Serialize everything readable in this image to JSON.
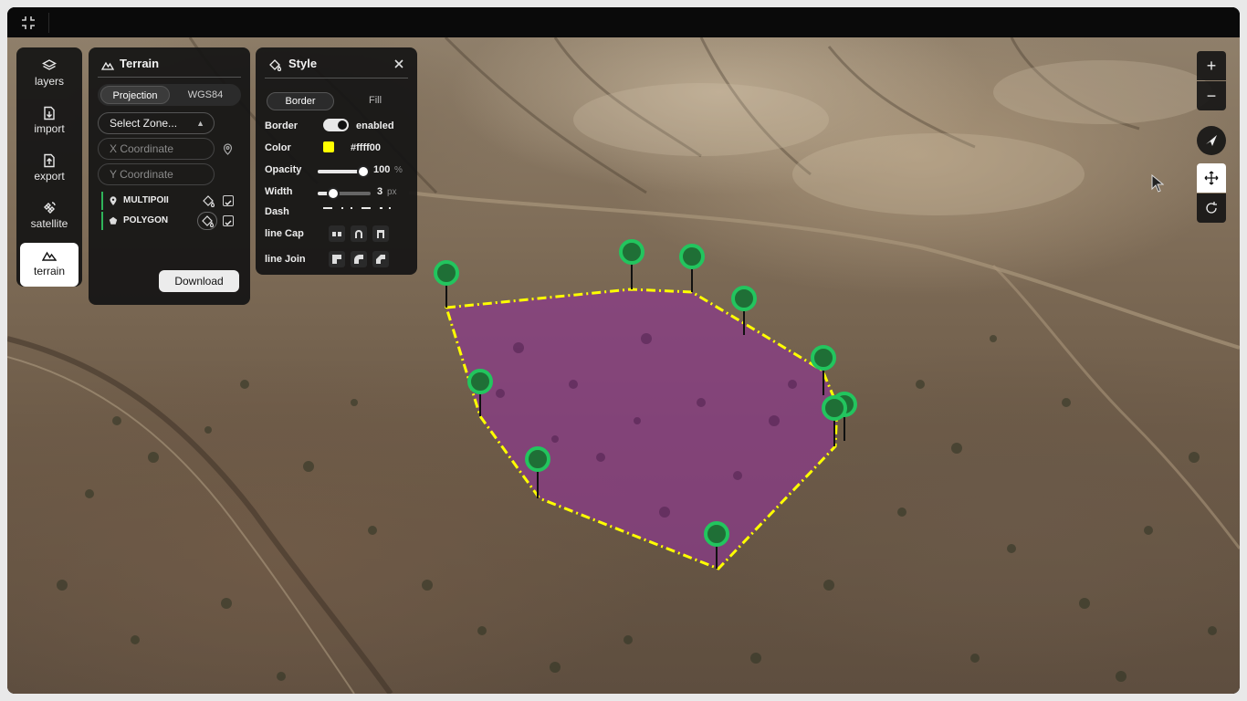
{
  "sidebar": {
    "items": [
      {
        "label": "layers",
        "icon": "layers-icon"
      },
      {
        "label": "import",
        "icon": "import-icon"
      },
      {
        "label": "export",
        "icon": "export-icon"
      },
      {
        "label": "satellite",
        "icon": "satellite-icon"
      },
      {
        "label": "terrain",
        "icon": "terrain-icon",
        "active": true
      }
    ]
  },
  "terrain_panel": {
    "title": "Terrain",
    "tabs": [
      {
        "label": "Projection",
        "active": true
      },
      {
        "label": "WGS84",
        "active": false
      }
    ],
    "zone_select": "Select Zone...",
    "x_placeholder": "X Coordinate",
    "y_placeholder": "Y Coordinate",
    "layers": [
      {
        "label": "MULTIPOII",
        "icon": "pin-icon",
        "checked": true
      },
      {
        "label": "POLYGON",
        "icon": "polygon-icon",
        "checked": true
      }
    ],
    "download_label": "Download"
  },
  "style_panel": {
    "title": "Style",
    "tabs": [
      {
        "label": "Border",
        "active": true
      },
      {
        "label": "Fill",
        "active": false
      }
    ],
    "border_label": "Border",
    "border_state": "enabled",
    "color_label": "Color",
    "color_value": "#ffff00",
    "opacity_label": "Opacity",
    "opacity_value": "100",
    "opacity_fraction": 1.0,
    "opacity_unit": "%",
    "width_label": "Width",
    "width_value": "3",
    "width_fraction": 0.3,
    "width_unit": "px",
    "dash_label": "Dash",
    "line_cap_label": "line Cap",
    "line_join_label": "line Join"
  },
  "map_controls": {
    "zoom_in": "+",
    "zoom_out": "−"
  },
  "colors": {
    "polygon_fill": "#8a3a8a",
    "polygon_border": "#ffff00",
    "marker": "#22c55e",
    "accent": "#2fb35a"
  }
}
